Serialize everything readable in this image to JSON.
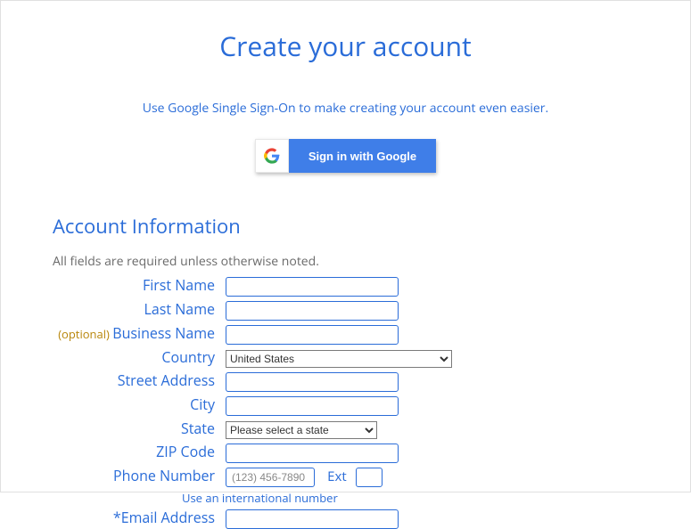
{
  "header": {
    "title": "Create your account",
    "sso_subtitle": "Use Google Single Sign-On to make creating your account even easier.",
    "google_button": "Sign in with Google"
  },
  "section": {
    "title": "Account Information",
    "required_note": "All fields are required unless otherwise noted."
  },
  "labels": {
    "first_name": "First Name",
    "last_name": "Last Name",
    "business_name": "Business Name",
    "optional": "(optional) ",
    "country": "Country",
    "street_address": "Street Address",
    "city": "City",
    "state": "State",
    "zip_code": "ZIP Code",
    "phone_number": "Phone Number",
    "ext": "Ext",
    "intl_link": "Use an international number",
    "email": "*Email Address"
  },
  "values": {
    "first_name": "",
    "last_name": "",
    "business_name": "",
    "country": "United States",
    "street_address": "",
    "city": "",
    "state": "Please select a state",
    "zip_code": "",
    "phone_placeholder": "(123) 456-7890",
    "phone": "",
    "ext": "",
    "email": ""
  }
}
